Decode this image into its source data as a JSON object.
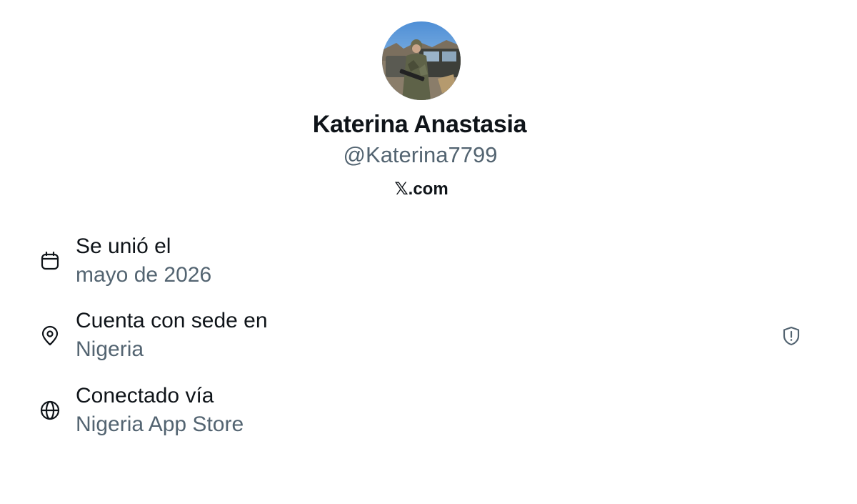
{
  "profile": {
    "display_name": "Katerina Anastasia",
    "handle": "@Katerina7799",
    "site": "𝕏.com"
  },
  "about": {
    "joined": {
      "title": "Se unió el",
      "value": "mayo de 2026",
      "icon": "calendar-icon"
    },
    "location": {
      "title": "Cuenta con sede en",
      "value": "Nigeria",
      "icon": "location-pin-icon"
    },
    "connected": {
      "title": "Conectado vía",
      "value": "Nigeria App Store",
      "icon": "globe-icon"
    }
  },
  "badges": {
    "info_icon": "shield-alert-icon"
  },
  "colors": {
    "primary_text": "#0f1419",
    "secondary_text": "#536471",
    "background": "#ffffff"
  }
}
